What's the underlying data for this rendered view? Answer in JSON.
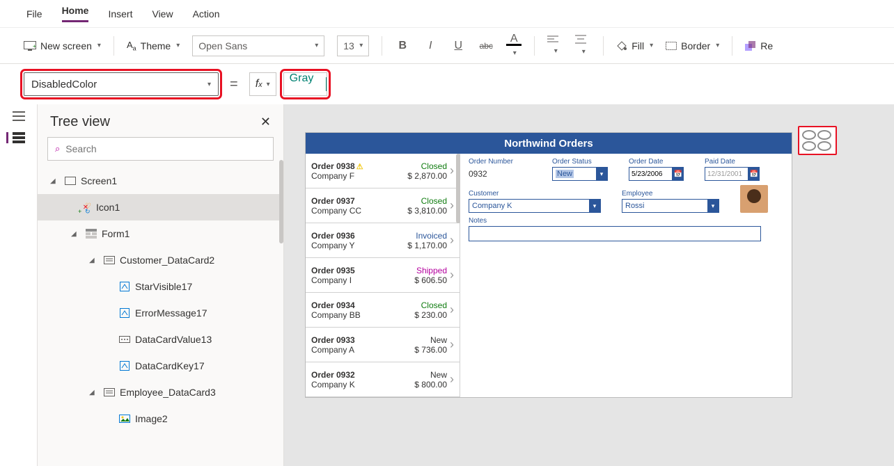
{
  "menu": {
    "file": "File",
    "home": "Home",
    "insert": "Insert",
    "view": "View",
    "action": "Action"
  },
  "ribbon": {
    "new_screen": "New screen",
    "theme": "Theme",
    "font": "Open Sans",
    "font_size": "13",
    "fill": "Fill",
    "border": "Border",
    "reorder": "Re"
  },
  "formula": {
    "property": "DisabledColor",
    "value": "Gray"
  },
  "treeview": {
    "title": "Tree view",
    "search_placeholder": "Search",
    "items": {
      "screen1": "Screen1",
      "icon1": "Icon1",
      "form1": "Form1",
      "customer_dc": "Customer_DataCard2",
      "starvisible": "StarVisible17",
      "errmsg": "ErrorMessage17",
      "dcv": "DataCardValue13",
      "dck": "DataCardKey17",
      "employee_dc": "Employee_DataCard3",
      "image2": "Image2"
    }
  },
  "app_preview": {
    "title": "Northwind Orders",
    "orders": [
      {
        "num": "Order 0938",
        "co": "Company F",
        "status": "Closed",
        "cls": "status-closed",
        "amt": "$ 2,870.00",
        "warn": true
      },
      {
        "num": "Order 0937",
        "co": "Company CC",
        "status": "Closed",
        "cls": "status-closed",
        "amt": "$ 3,810.00"
      },
      {
        "num": "Order 0936",
        "co": "Company Y",
        "status": "Invoiced",
        "cls": "status-inv",
        "amt": "$ 1,170.00"
      },
      {
        "num": "Order 0935",
        "co": "Company I",
        "status": "Shipped",
        "cls": "status-ship",
        "amt": "$ 606.50"
      },
      {
        "num": "Order 0934",
        "co": "Company BB",
        "status": "Closed",
        "cls": "status-closed",
        "amt": "$ 230.00"
      },
      {
        "num": "Order 0933",
        "co": "Company A",
        "status": "New",
        "cls": "status-new",
        "amt": "$ 736.00"
      },
      {
        "num": "Order 0932",
        "co": "Company K",
        "status": "New",
        "cls": "status-new",
        "amt": "$ 800.00"
      }
    ],
    "form": {
      "order_number_lbl": "Order Number",
      "order_number": "0932",
      "order_status_lbl": "Order Status",
      "order_status": "New",
      "order_date_lbl": "Order Date",
      "order_date": "5/23/2006",
      "paid_date_lbl": "Paid Date",
      "paid_date": "12/31/2001",
      "customer_lbl": "Customer",
      "customer": "Company K",
      "employee_lbl": "Employee",
      "employee": "Rossi",
      "notes_lbl": "Notes"
    }
  }
}
